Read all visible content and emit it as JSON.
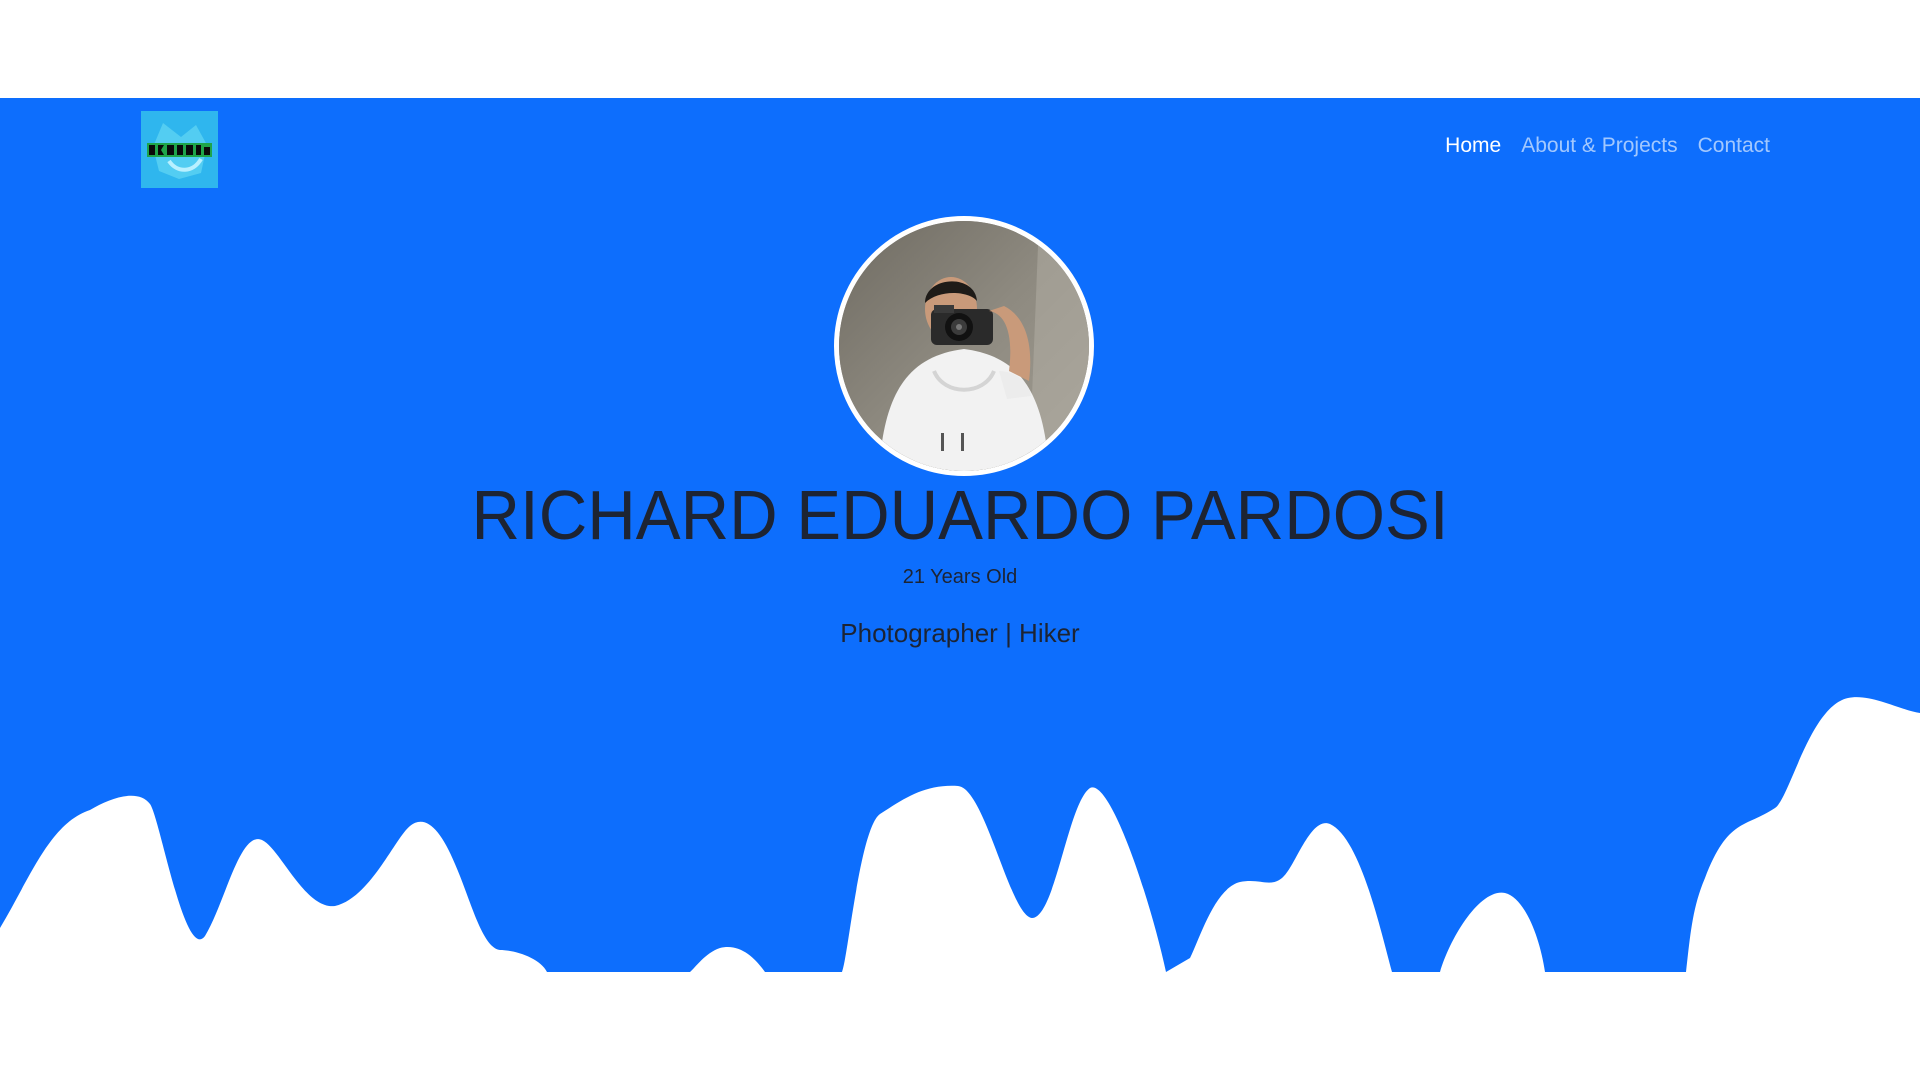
{
  "colors": {
    "hero_background": "#0d6efd",
    "logo_background": "#2fb6ee",
    "text_dark": "#1d2433",
    "nav_inactive": "rgba(255,255,255,0.62)",
    "nav_active": "#ffffff"
  },
  "navbar": {
    "logo_icon": "brand-logo-icon",
    "links": [
      {
        "label": "Home",
        "active": true
      },
      {
        "label": "About & Projects",
        "active": false
      },
      {
        "label": "Contact",
        "active": false
      }
    ]
  },
  "profile": {
    "photo_icon": "profile-photo",
    "name": "RICHARD EDUARDO PARDOSI",
    "age": "21 Years Old",
    "tagline": "Photographer | Hiker"
  }
}
